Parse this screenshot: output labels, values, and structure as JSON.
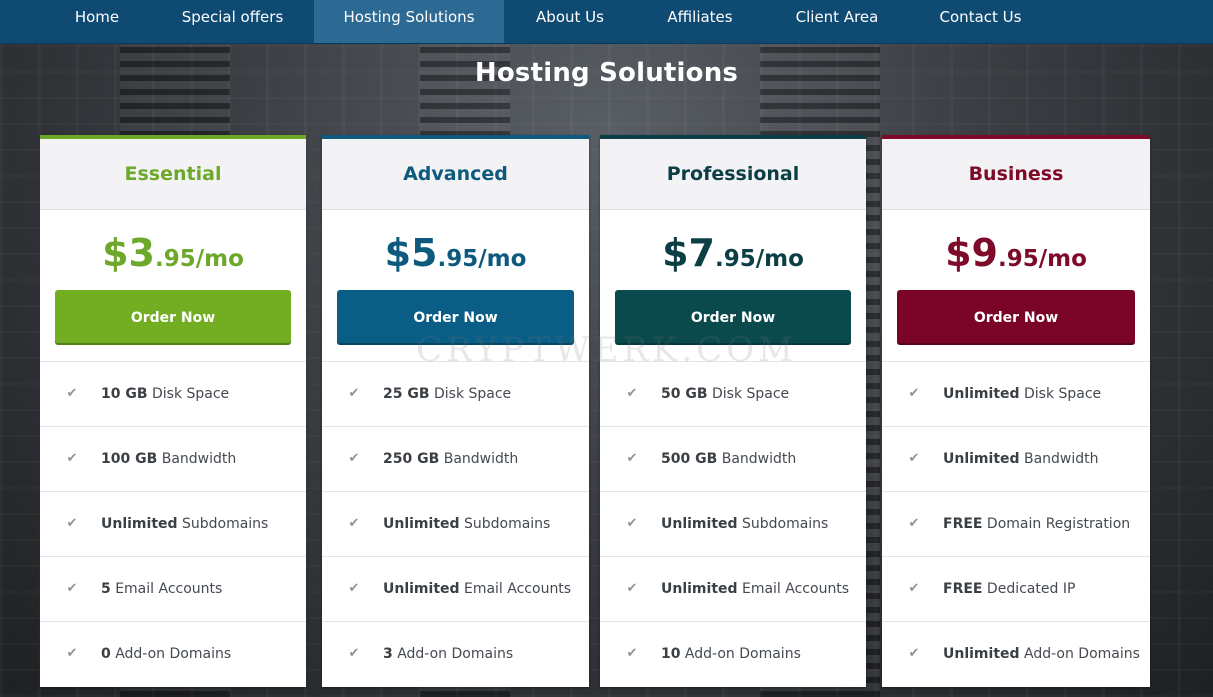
{
  "nav": {
    "items": [
      {
        "label": "Home",
        "active": false
      },
      {
        "label": "Special offers",
        "active": false
      },
      {
        "label": "Hosting Solutions",
        "active": true
      },
      {
        "label": "About Us",
        "active": false
      },
      {
        "label": "Affiliates",
        "active": false
      },
      {
        "label": "Client Area",
        "active": false
      },
      {
        "label": "Contact Us",
        "active": false
      }
    ]
  },
  "page": {
    "title": "Hosting Solutions"
  },
  "watermark": "CRYPTWERK.COM",
  "plans": [
    {
      "name": "Essential",
      "color": "#6da82a",
      "header_color": "#6da82a",
      "button_color": "#72ad22",
      "price_whole": "$3",
      "price_cents": ".95/mo",
      "button_label": "Order Now",
      "features": [
        {
          "bold": "10 GB",
          "text": " Disk Space"
        },
        {
          "bold": "100 GB",
          "text": " Bandwidth"
        },
        {
          "bold": "Unlimited",
          "text": " Subdomains"
        },
        {
          "bold": "5",
          "text": " Email Accounts"
        },
        {
          "bold": "0",
          "text": " Add-on Domains"
        }
      ]
    },
    {
      "name": "Advanced",
      "color": "#0d5a7e",
      "header_color": "#0d5a7e",
      "button_color": "#0a5d85",
      "price_whole": "$5",
      "price_cents": ".95/mo",
      "button_label": "Order Now",
      "features": [
        {
          "bold": "25 GB",
          "text": " Disk Space"
        },
        {
          "bold": "250 GB",
          "text": " Bandwidth"
        },
        {
          "bold": "Unlimited",
          "text": " Subdomains"
        },
        {
          "bold": "Unlimited",
          "text": " Email Accounts"
        },
        {
          "bold": "3",
          "text": " Add-on Domains"
        }
      ]
    },
    {
      "name": "Professional",
      "color": "#0b3e45",
      "header_color": "#0b3e45",
      "button_color": "#0a4a4d",
      "price_whole": "$7",
      "price_cents": ".95/mo",
      "button_label": "Order Now",
      "features": [
        {
          "bold": "50 GB",
          "text": " Disk Space"
        },
        {
          "bold": "500 GB",
          "text": " Bandwidth"
        },
        {
          "bold": "Unlimited",
          "text": " Subdomains"
        },
        {
          "bold": "Unlimited",
          "text": " Email Accounts"
        },
        {
          "bold": "10",
          "text": " Add-on Domains"
        }
      ]
    },
    {
      "name": "Business",
      "color": "#7e0a2a",
      "header_color": "#7e0a2a",
      "button_color": "#7a0428",
      "price_whole": "$9",
      "price_cents": ".95/mo",
      "button_label": "Order Now",
      "features": [
        {
          "bold": "Unlimited",
          "text": " Disk Space"
        },
        {
          "bold": "Unlimited",
          "text": " Bandwidth"
        },
        {
          "bold": "FREE",
          "text": " Domain Registration"
        },
        {
          "bold": "FREE",
          "text": " Dedicated IP"
        },
        {
          "bold": "Unlimited",
          "text": " Add-on Domains"
        }
      ]
    }
  ]
}
